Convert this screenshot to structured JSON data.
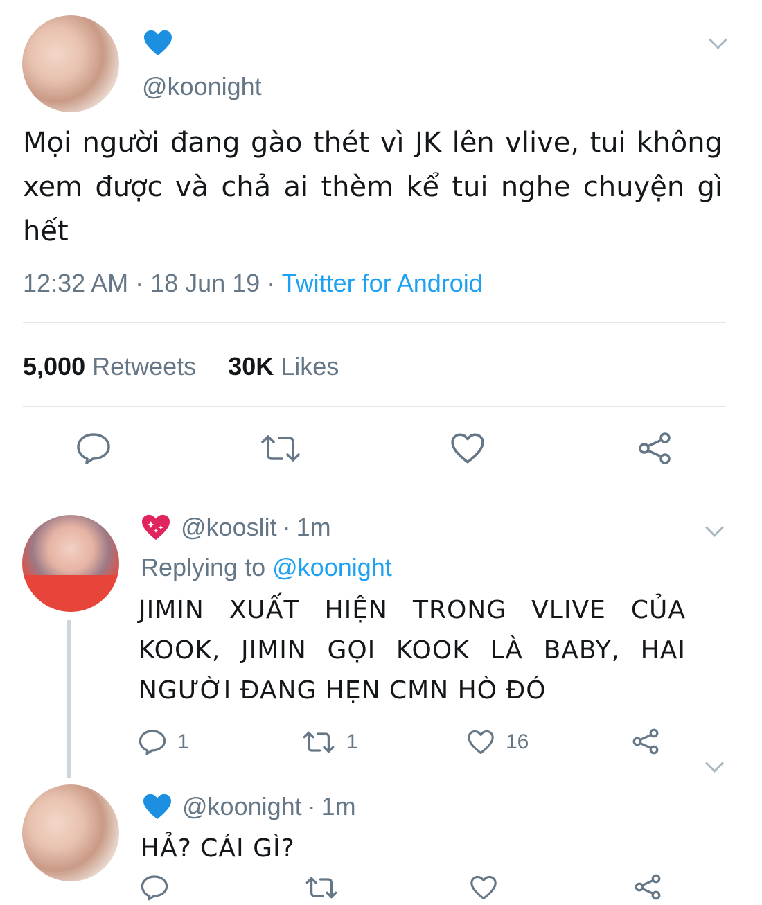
{
  "tweet": {
    "display_name_icon": "blue-heart-icon",
    "handle": "@koonight",
    "text": "Mọi người đang gào thét vì JK lên vlive, tui không xem được và chả ai thèm kể tui nghe chuyện gì hết",
    "time": "12:32 AM",
    "separator": "·",
    "date": "18 Jun 19",
    "source": "Twitter for Android",
    "retweets_count": "5,000",
    "retweets_label": "Retweets",
    "likes_count": "30K",
    "likes_label": "Likes"
  },
  "replies": [
    {
      "name_icon": "sparkling-heart-icon",
      "handle": "@kooslit",
      "separator": "·",
      "time": "1m",
      "replying_label": "Replying to",
      "replying_handle": "@koonight",
      "text": "JIMIN XUẤT HIỆN TRONG VLIVE CỦA KOOK, JIMIN GỌI KOOK LÀ BABY, HAI NGƯỜI ĐANG HẸN CMN HÒ ĐÓ",
      "reply_count": "1",
      "retweet_count": "1",
      "like_count": "16"
    },
    {
      "name_icon": "blue-heart-icon",
      "handle": "@koonight",
      "separator": "·",
      "time": "1m",
      "text": "HẢ? CÁI GÌ?"
    }
  ],
  "colors": {
    "accent": "#1da1f2",
    "muted": "#657786",
    "divider": "#e1e8ed",
    "blue_heart": "#1d8fe1"
  }
}
